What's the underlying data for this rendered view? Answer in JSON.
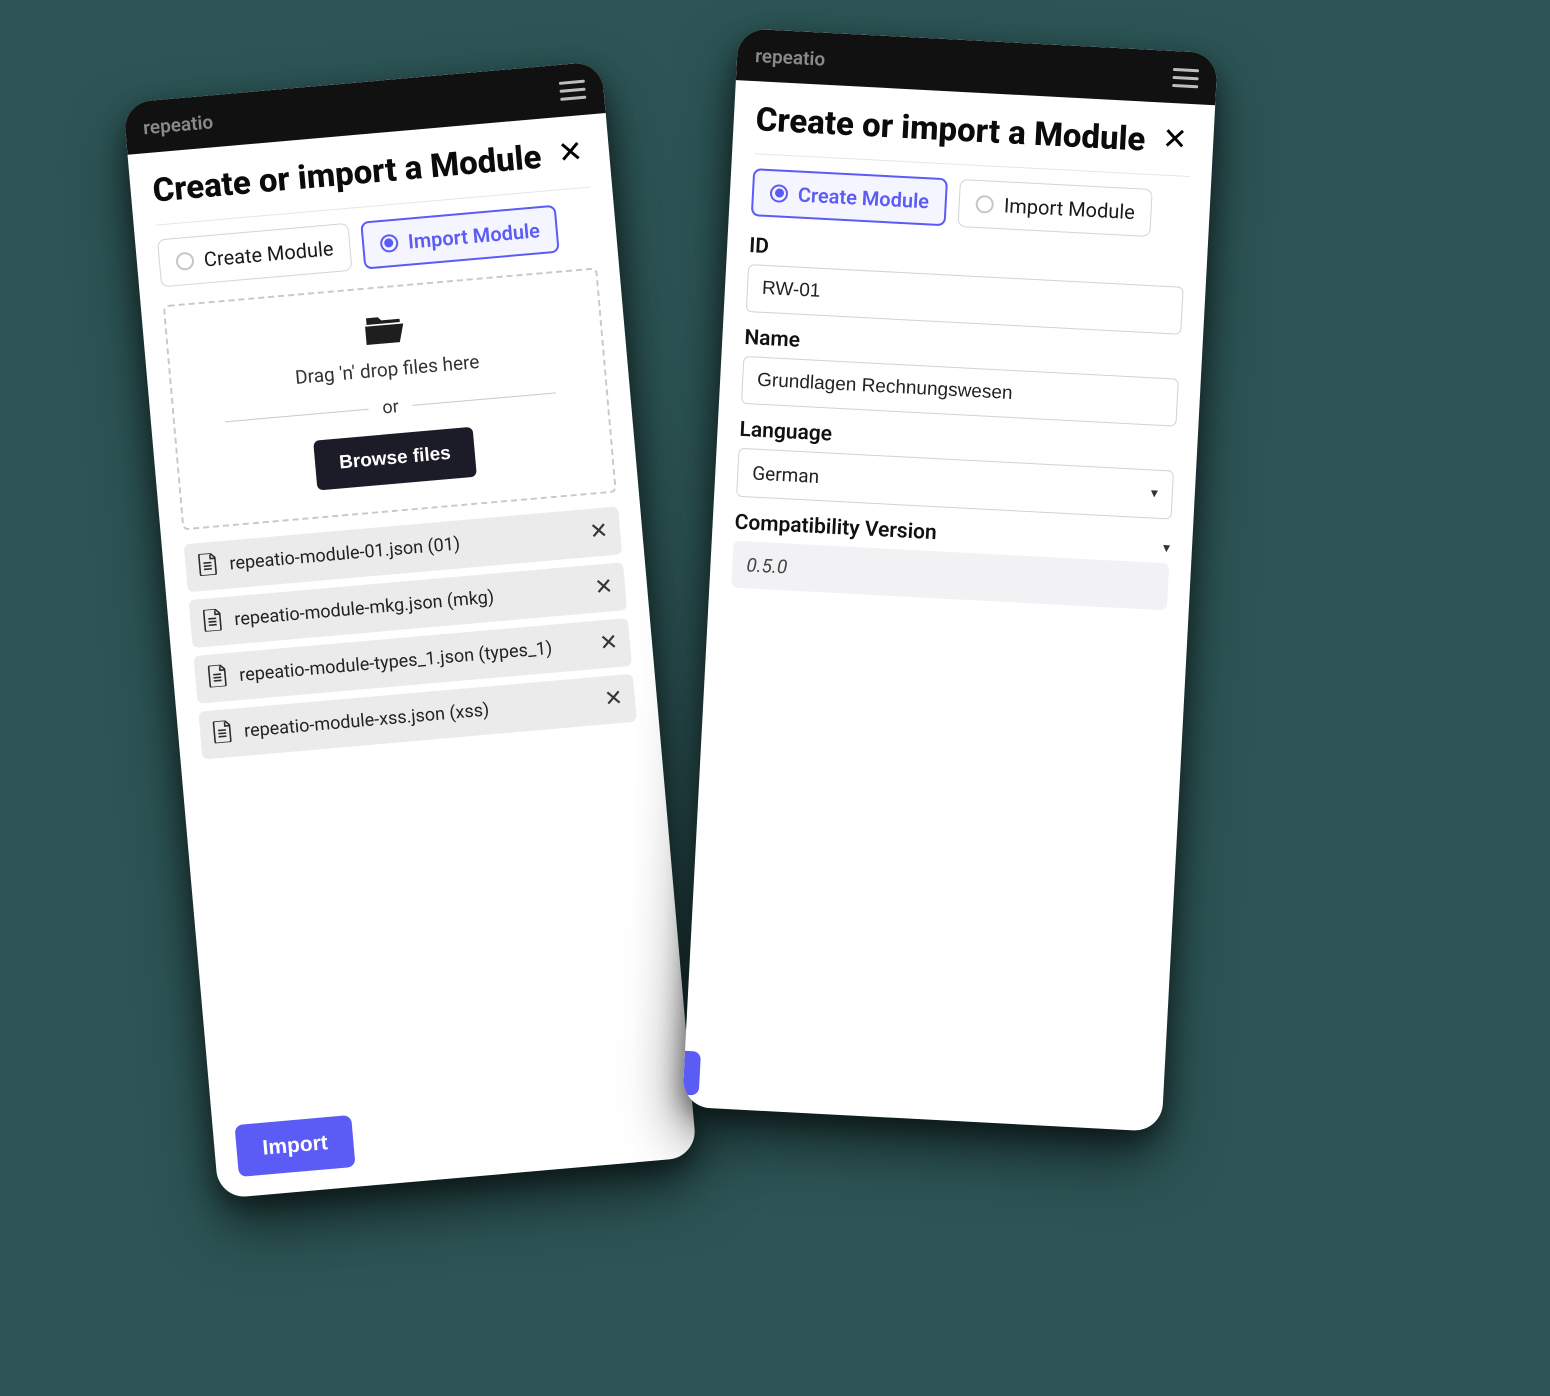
{
  "brand": "repeatio",
  "modal_title": "Create or import a Module",
  "toggle": {
    "create": "Create Module",
    "import": "Import Module"
  },
  "dropzone": {
    "drag_text": "Drag 'n' drop files here",
    "or_text": "or",
    "browse_label": "Browse files"
  },
  "files": [
    "repeatio-module-01.json (01)",
    "repeatio-module-mkg.json (mkg)",
    "repeatio-module-types_1.json (types_1)",
    "repeatio-module-xss.json (xss)"
  ],
  "import_button": "Import",
  "form": {
    "id_label": "ID",
    "id_value": "RW-01",
    "name_label": "Name",
    "name_value": "Grundlagen Rechnungswesen",
    "language_label": "Language",
    "language_value": "German",
    "compat_label": "Compatibility Version",
    "compat_value": "0.5.0"
  }
}
